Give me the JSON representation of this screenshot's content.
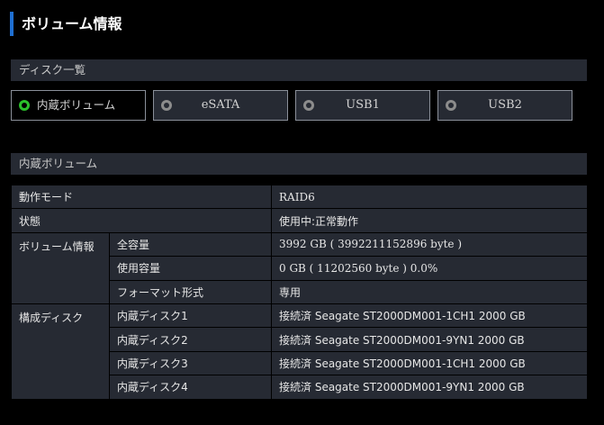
{
  "page": {
    "title": "ボリューム情報"
  },
  "disk_section": {
    "header": "ディスク一覧",
    "tabs": [
      {
        "label": "内蔵ボリューム",
        "selected": true
      },
      {
        "label": "eSATA",
        "selected": false
      },
      {
        "label": "USB1",
        "selected": false
      },
      {
        "label": "USB2",
        "selected": false
      }
    ]
  },
  "volume_section": {
    "header": "内蔵ボリューム",
    "rows": {
      "mode": {
        "label": "動作モード",
        "value": "RAID6"
      },
      "state": {
        "label": "状態",
        "value": "使用中:正常動作"
      },
      "volume_info": {
        "label": "ボリューム情報",
        "total": {
          "label": "全容量",
          "value": "3992 GB ( 3992211152896 byte )"
        },
        "used": {
          "label": "使用容量",
          "value": "0 GB ( 11202560 byte ) 0.0%"
        },
        "format": {
          "label": "フォーマット形式",
          "value": "専用"
        }
      },
      "disks": {
        "label": "構成ディスク",
        "items": [
          {
            "label": "内蔵ディスク1",
            "value": "接続済 Seagate ST2000DM001-1CH1 2000 GB"
          },
          {
            "label": "内蔵ディスク2",
            "value": "接続済 Seagate ST2000DM001-9YN1 2000 GB"
          },
          {
            "label": "内蔵ディスク3",
            "value": "接続済 Seagate ST2000DM001-1CH1 2000 GB"
          },
          {
            "label": "内蔵ディスク4",
            "value": "接続済 Seagate ST2000DM001-9YN1 2000 GB"
          }
        ]
      }
    }
  },
  "colors": {
    "accent": "#1f6fd1",
    "panel": "#262a33",
    "radio_active": "#2bc02b",
    "radio_inactive": "#8c8c8c"
  }
}
